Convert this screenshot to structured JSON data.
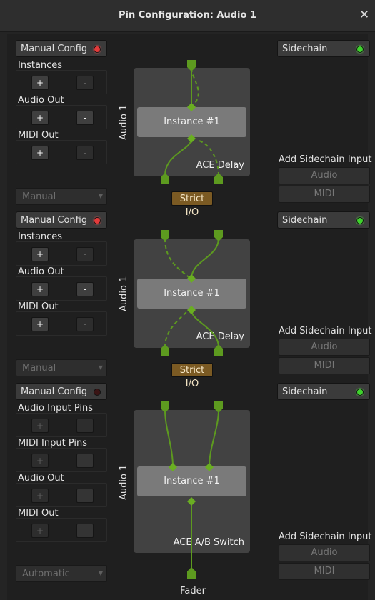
{
  "window": {
    "title": "Pin Configuration: Audio 1",
    "close_glyph": "✕"
  },
  "sections": [
    {
      "manual_config_label": "Manual Config",
      "sidechain_label": "Sidechain",
      "groups": [
        {
          "label": "Instances",
          "plus": "+",
          "minus": "-"
        },
        {
          "label": "Audio Out",
          "plus": "+",
          "minus": "-"
        },
        {
          "label": "MIDI Out",
          "plus": "+",
          "minus": "-"
        }
      ],
      "mode_value": "Manual",
      "plugin_label": "ACE Delay",
      "instance_label": "Instance #1",
      "track_label": "Audio 1",
      "strict_io_label": "Strict I/O",
      "add_sidechain_label": "Add Sidechain Input",
      "add_audio_label": "Audio",
      "add_midi_label": "MIDI"
    },
    {
      "manual_config_label": "Manual Config",
      "sidechain_label": "Sidechain",
      "groups": [
        {
          "label": "Instances",
          "plus": "+",
          "minus": "-"
        },
        {
          "label": "Audio Out",
          "plus": "+",
          "minus": "-"
        },
        {
          "label": "MIDI Out",
          "plus": "+",
          "minus": "-"
        }
      ],
      "mode_value": "Manual",
      "plugin_label": "ACE Delay",
      "instance_label": "Instance #1",
      "track_label": "Audio 1",
      "strict_io_label": "Strict I/O",
      "add_sidechain_label": "Add Sidechain Input",
      "add_audio_label": "Audio",
      "add_midi_label": "MIDI"
    },
    {
      "manual_config_label": "Manual Config",
      "sidechain_label": "Sidechain",
      "groups": [
        {
          "label": "Audio Input Pins",
          "plus": "+",
          "minus": "-"
        },
        {
          "label": "MIDI Input Pins",
          "plus": "+",
          "minus": "-"
        },
        {
          "label": "Audio Out",
          "plus": "+",
          "minus": "-"
        },
        {
          "label": "MIDI Out",
          "plus": "+",
          "minus": "-"
        }
      ],
      "mode_value": "Automatic",
      "plugin_label": "ACE A/B Switch",
      "instance_label": "Instance #1",
      "track_label": "Audio 1",
      "add_sidechain_label": "Add Sidechain Input",
      "add_audio_label": "Audio",
      "add_midi_label": "MIDI"
    }
  ],
  "footer": {
    "fader_label": "Fader"
  },
  "colors": {
    "wire": "#5d9a1f",
    "led_red": "#e33b3b",
    "led_green": "#3fd22d",
    "strict_io_bg": "#7b5a23"
  },
  "icons": {
    "close": "close-icon",
    "diamond": "pin-diamond-icon"
  }
}
